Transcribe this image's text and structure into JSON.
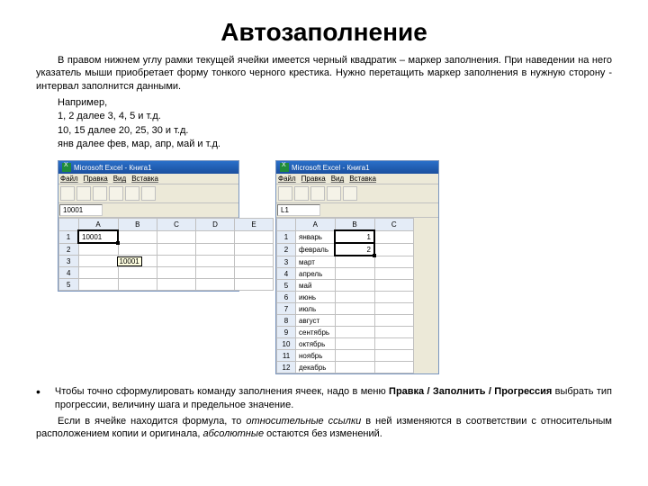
{
  "title": "Автозаполнение",
  "intro": "В правом нижнем углу рамки текущей ячейки имеется черный квадратик – маркер заполнения. При наведении на него указатель мыши приобретает форму тонкого черного крестика. Нужно перетащить маркер заполнения в нужную сторону - интервал заполнится данными.",
  "example_label": "Например,",
  "ex1": "1, 2 далее 3, 4, 5 и т.д.",
  "ex2": "10, 15 далее 20, 25, 30 и т.д.",
  "ex3": "янв далее фев, мар, апр, май и т.д.",
  "excel1": {
    "title": "Microsoft Excel - Книга1",
    "menu": [
      "Файл",
      "Правка",
      "Вид",
      "Вставка"
    ],
    "namebox": "10001",
    "cols": [
      "A",
      "B",
      "C",
      "D",
      "E"
    ],
    "r1": "10001",
    "tooltip": "10001"
  },
  "excel2": {
    "title": "Microsoft Excel - Книга1",
    "menu": [
      "Файл",
      "Правка",
      "Вид",
      "Вставка"
    ],
    "namebox": "L1",
    "cols": [
      "A",
      "B",
      "C"
    ],
    "months": [
      "январь",
      "февраль",
      "март",
      "апрель",
      "май",
      "июнь",
      "июль",
      "август",
      "сентябрь",
      "октябрь",
      "ноябрь",
      "декабрь"
    ],
    "b1": "1",
    "b2": "2"
  },
  "para2_a": "Чтобы точно сформулировать команду заполнения ячеек, надо в меню ",
  "para2_b": "Правка / Заполнить / Прогрессия",
  "para2_c": " выбрать тип прогрессии, величину шага и предельное значение.",
  "para3_a": "Если в ячейке находится формула, то ",
  "para3_b": "относительные ссылки",
  "para3_c": " в ней изменяются в соответствии с относительным расположением копии и оригинала, ",
  "para3_d": "абсолютные",
  "para3_e": " остаются без изменений."
}
